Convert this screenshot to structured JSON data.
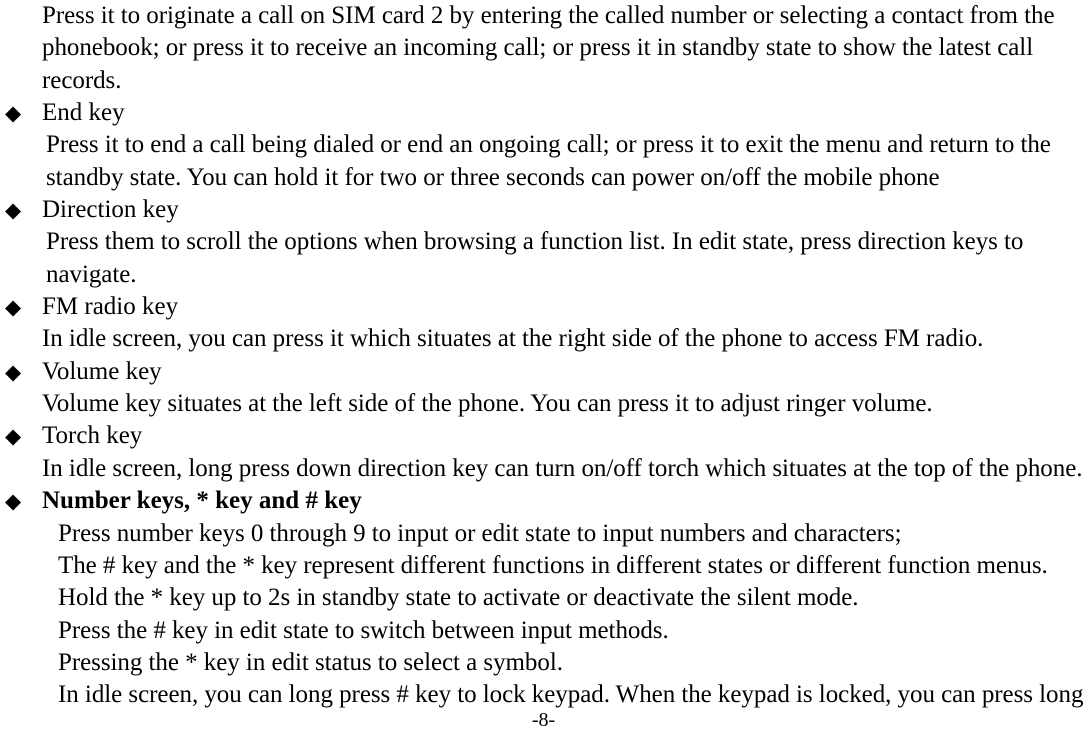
{
  "document": {
    "page_number_label": "-8-",
    "bullet_glyph": "◆",
    "blocks": [
      {
        "type": "paragraph",
        "indent": "indent-0",
        "lines": [
          "Press it to originate a call on SIM card 2 by entering the called number or selecting a contact from the",
          "phonebook; or press it to receive an incoming call; or press it in standby state to show the latest call",
          "records."
        ]
      },
      {
        "type": "bullet",
        "label": "End key",
        "bold": false
      },
      {
        "type": "paragraph",
        "indent": "indent-1",
        "lines": [
          "Press it to end a call being dialed or end an ongoing call; or press it to exit the menu and return to the",
          "standby state. You can hold it for two or three seconds can power on/off the mobile phone"
        ]
      },
      {
        "type": "bullet",
        "label": "Direction key",
        "bold": false
      },
      {
        "type": "paragraph",
        "indent": "indent-1",
        "lines": [
          "Press them to scroll the options when browsing a function list. In edit state, press direction keys to",
          "navigate."
        ]
      },
      {
        "type": "bullet",
        "label": "FM radio key",
        "bold": false
      },
      {
        "type": "paragraph",
        "indent": "indent-0",
        "lines": [
          "In idle screen, you can press it which situates at the right side of the phone to access FM radio."
        ]
      },
      {
        "type": "bullet",
        "label": "Volume key",
        "bold": false
      },
      {
        "type": "paragraph",
        "indent": "indent-0",
        "lines": [
          "Volume key situates at the left side of the phone. You can press it to adjust ringer volume."
        ]
      },
      {
        "type": "bullet",
        "label": "Torch key",
        "bold": false
      },
      {
        "type": "paragraph",
        "indent": "indent-0",
        "lines": [
          "In idle screen, long press down direction key can turn on/off torch which situates at the top of the phone."
        ]
      },
      {
        "type": "bullet",
        "label": "Number keys, * key and # key",
        "bold": true
      },
      {
        "type": "paragraph",
        "indent": "indent-2",
        "lines": [
          "Press number keys 0 through 9 to input or edit state to input numbers and characters;",
          "The # key and the * key represent different functions in different states or different function menus.",
          "Hold the * key up to 2s in standby state to activate or deactivate the silent mode.",
          "Press the # key in edit state to switch between input methods.",
          "Pressing the * key in edit status to select a symbol.",
          "In idle screen, you can long press # key to lock keypad. When the keypad is locked, you can press long"
        ]
      }
    ]
  }
}
